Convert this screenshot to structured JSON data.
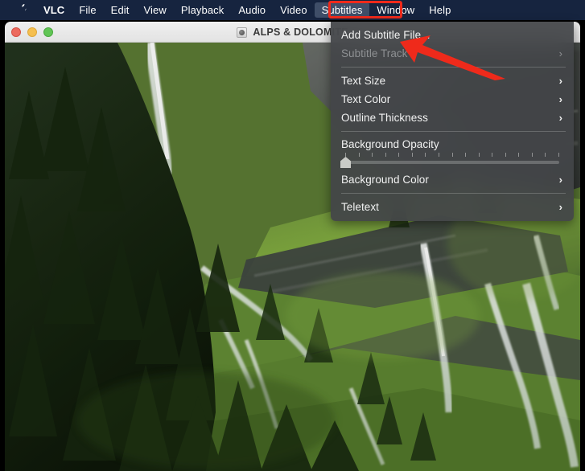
{
  "menubar": {
    "apple_icon": "apple-logo",
    "items": [
      {
        "label": "VLC",
        "bold": true,
        "active": false
      },
      {
        "label": "File",
        "bold": false,
        "active": false
      },
      {
        "label": "Edit",
        "bold": false,
        "active": false
      },
      {
        "label": "View",
        "bold": false,
        "active": false
      },
      {
        "label": "Playback",
        "bold": false,
        "active": false
      },
      {
        "label": "Audio",
        "bold": false,
        "active": false
      },
      {
        "label": "Video",
        "bold": false,
        "active": false
      },
      {
        "label": "Subtitles",
        "bold": false,
        "active": true
      },
      {
        "label": "Window",
        "bold": false,
        "active": false
      },
      {
        "label": "Help",
        "bold": false,
        "active": false
      }
    ],
    "background_color": "#16243f",
    "active_item_color": "#3f4e68",
    "text_color": "#ffffff"
  },
  "window": {
    "title": "ALPS & DOLOMITE",
    "title_icon": "disc-icon",
    "controls": {
      "close": "close-button",
      "minimize": "minimize-button",
      "zoom": "zoom-button"
    },
    "control_colors": {
      "close": "#ec6a5e",
      "minimize": "#f5bf4f",
      "zoom": "#61c555"
    }
  },
  "video": {
    "description": "Alpine mountainside with waterfalls, conifer forest and green meadows"
  },
  "dropdown": {
    "name": "subtitles-menu",
    "items": [
      {
        "label": "Add Subtitle File...",
        "disabled": false,
        "submenu": false
      },
      {
        "label": "Subtitle Track",
        "disabled": true,
        "submenu": true
      },
      {
        "type": "separator"
      },
      {
        "label": "Text Size",
        "disabled": false,
        "submenu": true
      },
      {
        "label": "Text Color",
        "disabled": false,
        "submenu": true
      },
      {
        "label": "Outline Thickness",
        "disabled": false,
        "submenu": true
      },
      {
        "type": "separator"
      },
      {
        "label": "Background Opacity",
        "type": "slider",
        "value": 0,
        "ticks": 17
      },
      {
        "label": "Background Color",
        "disabled": false,
        "submenu": true
      },
      {
        "type": "separator"
      },
      {
        "label": "Teletext",
        "disabled": false,
        "submenu": true
      }
    ],
    "chevron_glyph": "›",
    "background_color": "#434548",
    "text_color": "#f2f2f2",
    "disabled_text_color": "#8e9093"
  },
  "annotations": {
    "highlight_box": {
      "name": "subtitles-highlight-box",
      "color": "#ef2a1b"
    },
    "arrow": {
      "name": "pointer-arrow",
      "color": "#ef2a1b",
      "points_to": "Add Subtitle File..."
    }
  }
}
